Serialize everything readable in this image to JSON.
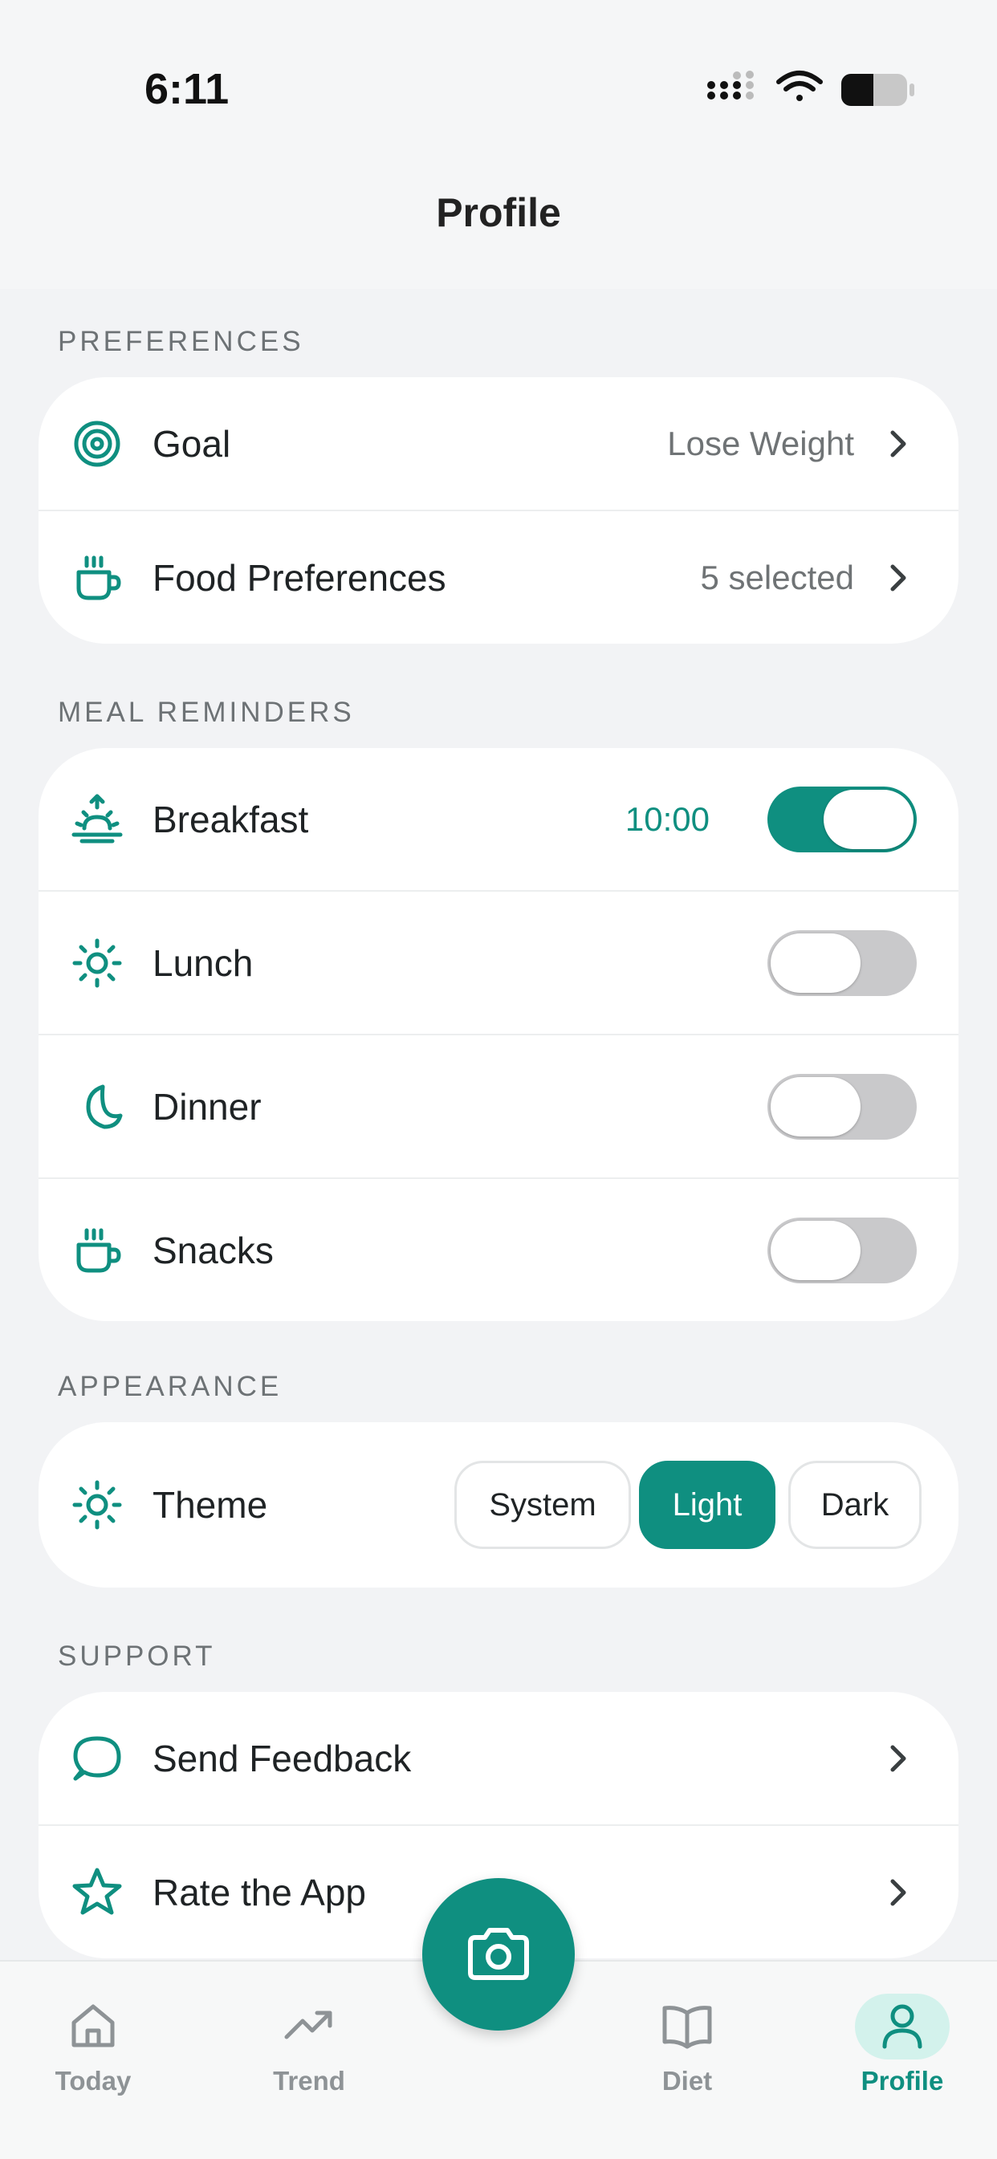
{
  "status_bar": {
    "time": "6:11"
  },
  "header": {
    "title": "Profile"
  },
  "sections": {
    "preferences": {
      "label": "PREFERENCES",
      "goal": {
        "label": "Goal",
        "value": "Lose Weight"
      },
      "food": {
        "label": "Food Preferences",
        "value": "5 selected"
      }
    },
    "meal_reminders": {
      "label": "MEAL REMINDERS",
      "breakfast": {
        "label": "Breakfast",
        "time": "10:00",
        "enabled": true
      },
      "lunch": {
        "label": "Lunch",
        "enabled": false
      },
      "dinner": {
        "label": "Dinner",
        "enabled": false
      },
      "snacks": {
        "label": "Snacks",
        "enabled": false
      }
    },
    "appearance": {
      "label": "APPEARANCE",
      "theme": {
        "label": "Theme",
        "options": [
          "System",
          "Light",
          "Dark"
        ],
        "selected": "Light"
      }
    },
    "support": {
      "label": "SUPPORT",
      "feedback": {
        "label": "Send Feedback"
      },
      "rate": {
        "label": "Rate the App"
      }
    }
  },
  "tabbar": {
    "today": "Today",
    "trend": "Trend",
    "diet": "Diet",
    "profile": "Profile",
    "active": "Profile"
  },
  "colors": {
    "accent": "#0f8f80",
    "accent_light": "#d3f2ec",
    "toggle_off": "#c9c9cb",
    "background": "#f2f3f5"
  },
  "icons": {
    "goal": "target-icon",
    "food": "coffee-cup-icon",
    "breakfast": "sunrise-icon",
    "lunch": "sun-icon",
    "dinner": "moon-icon",
    "snacks": "coffee-cup-icon",
    "theme": "sun-icon",
    "feedback": "chat-bubble-icon",
    "rate": "star-icon",
    "fab": "camera-icon"
  }
}
